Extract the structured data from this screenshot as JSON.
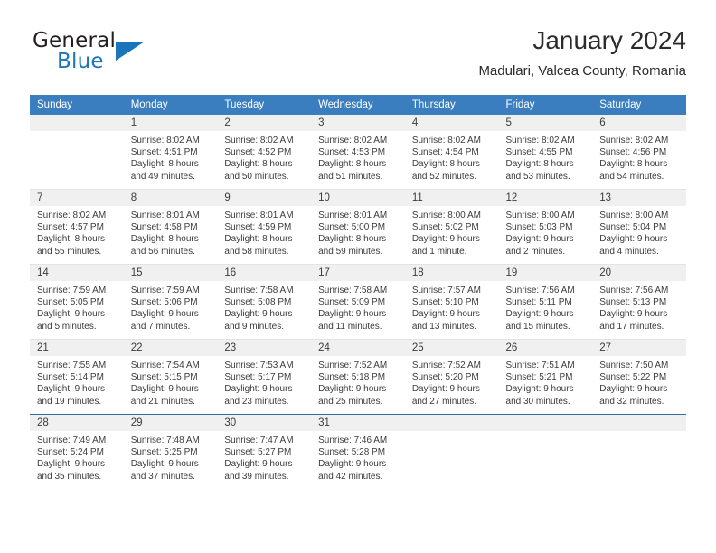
{
  "brand": {
    "name_part1": "General",
    "name_part2": "Blue",
    "triangle_color": "#1b75bb"
  },
  "header": {
    "title": "January 2024",
    "subtitle": "Madulari, Valcea County, Romania"
  },
  "theme": {
    "header_row_bg": "#3a7ebf",
    "daynum_bg": "#f0f0f0",
    "last_row_divider": "#2d6ca8",
    "week_divider": "#e3e3e3",
    "text": "#3b3b3b"
  },
  "weekday_headers": [
    "Sunday",
    "Monday",
    "Tuesday",
    "Wednesday",
    "Thursday",
    "Friday",
    "Saturday"
  ],
  "weeks": [
    [
      {
        "day": "",
        "sunrise": "",
        "sunset": "",
        "daylight1": "",
        "daylight2": ""
      },
      {
        "day": "1",
        "sunrise": "Sunrise: 8:02 AM",
        "sunset": "Sunset: 4:51 PM",
        "daylight1": "Daylight: 8 hours",
        "daylight2": "and 49 minutes."
      },
      {
        "day": "2",
        "sunrise": "Sunrise: 8:02 AM",
        "sunset": "Sunset: 4:52 PM",
        "daylight1": "Daylight: 8 hours",
        "daylight2": "and 50 minutes."
      },
      {
        "day": "3",
        "sunrise": "Sunrise: 8:02 AM",
        "sunset": "Sunset: 4:53 PM",
        "daylight1": "Daylight: 8 hours",
        "daylight2": "and 51 minutes."
      },
      {
        "day": "4",
        "sunrise": "Sunrise: 8:02 AM",
        "sunset": "Sunset: 4:54 PM",
        "daylight1": "Daylight: 8 hours",
        "daylight2": "and 52 minutes."
      },
      {
        "day": "5",
        "sunrise": "Sunrise: 8:02 AM",
        "sunset": "Sunset: 4:55 PM",
        "daylight1": "Daylight: 8 hours",
        "daylight2": "and 53 minutes."
      },
      {
        "day": "6",
        "sunrise": "Sunrise: 8:02 AM",
        "sunset": "Sunset: 4:56 PM",
        "daylight1": "Daylight: 8 hours",
        "daylight2": "and 54 minutes."
      }
    ],
    [
      {
        "day": "7",
        "sunrise": "Sunrise: 8:02 AM",
        "sunset": "Sunset: 4:57 PM",
        "daylight1": "Daylight: 8 hours",
        "daylight2": "and 55 minutes."
      },
      {
        "day": "8",
        "sunrise": "Sunrise: 8:01 AM",
        "sunset": "Sunset: 4:58 PM",
        "daylight1": "Daylight: 8 hours",
        "daylight2": "and 56 minutes."
      },
      {
        "day": "9",
        "sunrise": "Sunrise: 8:01 AM",
        "sunset": "Sunset: 4:59 PM",
        "daylight1": "Daylight: 8 hours",
        "daylight2": "and 58 minutes."
      },
      {
        "day": "10",
        "sunrise": "Sunrise: 8:01 AM",
        "sunset": "Sunset: 5:00 PM",
        "daylight1": "Daylight: 8 hours",
        "daylight2": "and 59 minutes."
      },
      {
        "day": "11",
        "sunrise": "Sunrise: 8:00 AM",
        "sunset": "Sunset: 5:02 PM",
        "daylight1": "Daylight: 9 hours",
        "daylight2": "and 1 minute."
      },
      {
        "day": "12",
        "sunrise": "Sunrise: 8:00 AM",
        "sunset": "Sunset: 5:03 PM",
        "daylight1": "Daylight: 9 hours",
        "daylight2": "and 2 minutes."
      },
      {
        "day": "13",
        "sunrise": "Sunrise: 8:00 AM",
        "sunset": "Sunset: 5:04 PM",
        "daylight1": "Daylight: 9 hours",
        "daylight2": "and 4 minutes."
      }
    ],
    [
      {
        "day": "14",
        "sunrise": "Sunrise: 7:59 AM",
        "sunset": "Sunset: 5:05 PM",
        "daylight1": "Daylight: 9 hours",
        "daylight2": "and 5 minutes."
      },
      {
        "day": "15",
        "sunrise": "Sunrise: 7:59 AM",
        "sunset": "Sunset: 5:06 PM",
        "daylight1": "Daylight: 9 hours",
        "daylight2": "and 7 minutes."
      },
      {
        "day": "16",
        "sunrise": "Sunrise: 7:58 AM",
        "sunset": "Sunset: 5:08 PM",
        "daylight1": "Daylight: 9 hours",
        "daylight2": "and 9 minutes."
      },
      {
        "day": "17",
        "sunrise": "Sunrise: 7:58 AM",
        "sunset": "Sunset: 5:09 PM",
        "daylight1": "Daylight: 9 hours",
        "daylight2": "and 11 minutes."
      },
      {
        "day": "18",
        "sunrise": "Sunrise: 7:57 AM",
        "sunset": "Sunset: 5:10 PM",
        "daylight1": "Daylight: 9 hours",
        "daylight2": "and 13 minutes."
      },
      {
        "day": "19",
        "sunrise": "Sunrise: 7:56 AM",
        "sunset": "Sunset: 5:11 PM",
        "daylight1": "Daylight: 9 hours",
        "daylight2": "and 15 minutes."
      },
      {
        "day": "20",
        "sunrise": "Sunrise: 7:56 AM",
        "sunset": "Sunset: 5:13 PM",
        "daylight1": "Daylight: 9 hours",
        "daylight2": "and 17 minutes."
      }
    ],
    [
      {
        "day": "21",
        "sunrise": "Sunrise: 7:55 AM",
        "sunset": "Sunset: 5:14 PM",
        "daylight1": "Daylight: 9 hours",
        "daylight2": "and 19 minutes."
      },
      {
        "day": "22",
        "sunrise": "Sunrise: 7:54 AM",
        "sunset": "Sunset: 5:15 PM",
        "daylight1": "Daylight: 9 hours",
        "daylight2": "and 21 minutes."
      },
      {
        "day": "23",
        "sunrise": "Sunrise: 7:53 AM",
        "sunset": "Sunset: 5:17 PM",
        "daylight1": "Daylight: 9 hours",
        "daylight2": "and 23 minutes."
      },
      {
        "day": "24",
        "sunrise": "Sunrise: 7:52 AM",
        "sunset": "Sunset: 5:18 PM",
        "daylight1": "Daylight: 9 hours",
        "daylight2": "and 25 minutes."
      },
      {
        "day": "25",
        "sunrise": "Sunrise: 7:52 AM",
        "sunset": "Sunset: 5:20 PM",
        "daylight1": "Daylight: 9 hours",
        "daylight2": "and 27 minutes."
      },
      {
        "day": "26",
        "sunrise": "Sunrise: 7:51 AM",
        "sunset": "Sunset: 5:21 PM",
        "daylight1": "Daylight: 9 hours",
        "daylight2": "and 30 minutes."
      },
      {
        "day": "27",
        "sunrise": "Sunrise: 7:50 AM",
        "sunset": "Sunset: 5:22 PM",
        "daylight1": "Daylight: 9 hours",
        "daylight2": "and 32 minutes."
      }
    ],
    [
      {
        "day": "28",
        "sunrise": "Sunrise: 7:49 AM",
        "sunset": "Sunset: 5:24 PM",
        "daylight1": "Daylight: 9 hours",
        "daylight2": "and 35 minutes."
      },
      {
        "day": "29",
        "sunrise": "Sunrise: 7:48 AM",
        "sunset": "Sunset: 5:25 PM",
        "daylight1": "Daylight: 9 hours",
        "daylight2": "and 37 minutes."
      },
      {
        "day": "30",
        "sunrise": "Sunrise: 7:47 AM",
        "sunset": "Sunset: 5:27 PM",
        "daylight1": "Daylight: 9 hours",
        "daylight2": "and 39 minutes."
      },
      {
        "day": "31",
        "sunrise": "Sunrise: 7:46 AM",
        "sunset": "Sunset: 5:28 PM",
        "daylight1": "Daylight: 9 hours",
        "daylight2": "and 42 minutes."
      },
      {
        "day": "",
        "sunrise": "",
        "sunset": "",
        "daylight1": "",
        "daylight2": ""
      },
      {
        "day": "",
        "sunrise": "",
        "sunset": "",
        "daylight1": "",
        "daylight2": ""
      },
      {
        "day": "",
        "sunrise": "",
        "sunset": "",
        "daylight1": "",
        "daylight2": ""
      }
    ]
  ]
}
